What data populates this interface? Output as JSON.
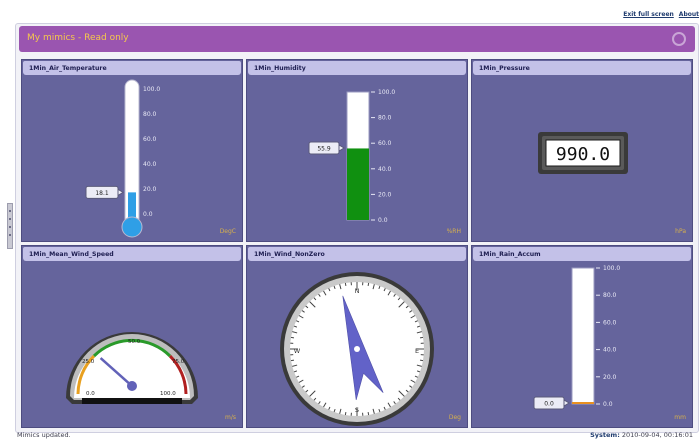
{
  "top_links": {
    "exit_full_screen": "Exit full screen",
    "about": "About"
  },
  "window": {
    "title": "My mimics - Read only"
  },
  "panels": {
    "air_temp": {
      "title": "1Min_Air_Temperature",
      "value": 18.1,
      "value_label": "18.1",
      "unit": "DegC",
      "scale_max": 100,
      "ticks": [
        "100.0",
        "80.0",
        "60.0",
        "40.0",
        "20.0",
        "0.0"
      ]
    },
    "humidity": {
      "title": "1Min_Humidity",
      "value": 55.9,
      "value_label": "55.9",
      "unit": "%RH",
      "scale_max": 100,
      "ticks": [
        "100.0",
        "80.0",
        "60.0",
        "40.0",
        "20.0",
        "0.0"
      ]
    },
    "pressure": {
      "title": "1Min_Pressure",
      "value_label": "990.0",
      "unit": "hPa"
    },
    "wind_speed": {
      "title": "1Min_Mean_Wind_Speed",
      "value": 28,
      "scale_max": 100,
      "labels": [
        "0.0",
        "25.0",
        "50.0",
        "75.0",
        "100.0"
      ],
      "unit": "m/s"
    },
    "wind_dir": {
      "title": "1Min_Wind_NonZero",
      "value_deg": 345,
      "cardinals": {
        "n": "N",
        "e": "E",
        "s": "S",
        "w": "W"
      },
      "unit": "Deg"
    },
    "rain": {
      "title": "1Min_Rain_Accum",
      "value": 0.0,
      "value_label": "0.0",
      "unit": "mm",
      "scale_max": 100,
      "ticks": [
        "100.0",
        "80.0",
        "60.0",
        "40.0",
        "20.0",
        "0.0"
      ]
    }
  },
  "colors": {
    "panel_bg": "#65649c",
    "title_bar": "#9a55b0",
    "title_text": "#f5c84c",
    "thermo_fill": "#2f9fe6",
    "humidity_fill": "#109010",
    "pointer": "#6262b8",
    "rain_marker": "#e89020"
  },
  "status": {
    "left": "Mimics updated.",
    "system_label": "System:",
    "system_time": "2010-09-04, 00:16:01"
  }
}
